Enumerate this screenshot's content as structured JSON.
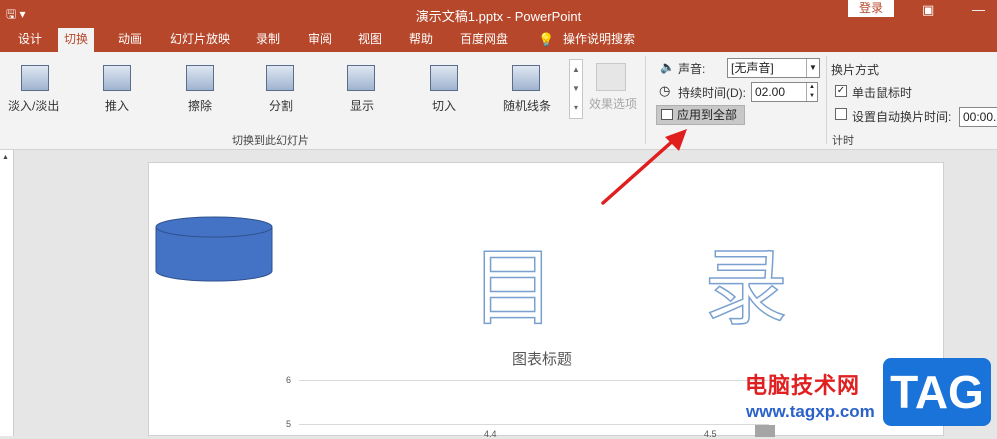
{
  "window": {
    "title": "演示文稿1.pptx - PowerPoint",
    "login": "登录",
    "restore_glyph": "▣",
    "minimize_glyph": "—",
    "qa_icon": "save-icon"
  },
  "tabs": [
    "设计",
    "切换",
    "动画",
    "幻灯片放映",
    "录制",
    "审阅",
    "视图",
    "帮助",
    "百度网盘",
    "操作说明搜索"
  ],
  "active_tab": "切换",
  "ribbon": {
    "transitions": [
      "淡入/淡出",
      "推入",
      "擦除",
      "分割",
      "显示",
      "切入",
      "随机线条"
    ],
    "effect_options": "效果选项",
    "group_label": "切换到此幻灯片",
    "sound_label": "声音:",
    "sound_value": "[无声音]",
    "duration_label": "持续时间(D):",
    "duration_value": "02.00",
    "apply_all": "应用到全部",
    "advance_title": "换片方式",
    "on_click": "单击鼠标时",
    "on_click_checked": true,
    "auto_after": "设置自动换片时间:",
    "auto_after_checked": false,
    "auto_time": "00:00.",
    "timing_label": "计时"
  },
  "slide": {
    "heading_char1": "目",
    "heading_char2": "录",
    "shape_color": "#4472c4"
  },
  "chart_data": {
    "type": "bar",
    "title": "图表标题",
    "y_ticks": [
      "6",
      "5"
    ],
    "visible_labels": [
      "4.4",
      "4.5"
    ],
    "ylim": [
      0,
      6
    ]
  },
  "watermark": {
    "site_cn": "电脑技术网",
    "url": "www.tagxp.com",
    "logo": "TAG"
  }
}
